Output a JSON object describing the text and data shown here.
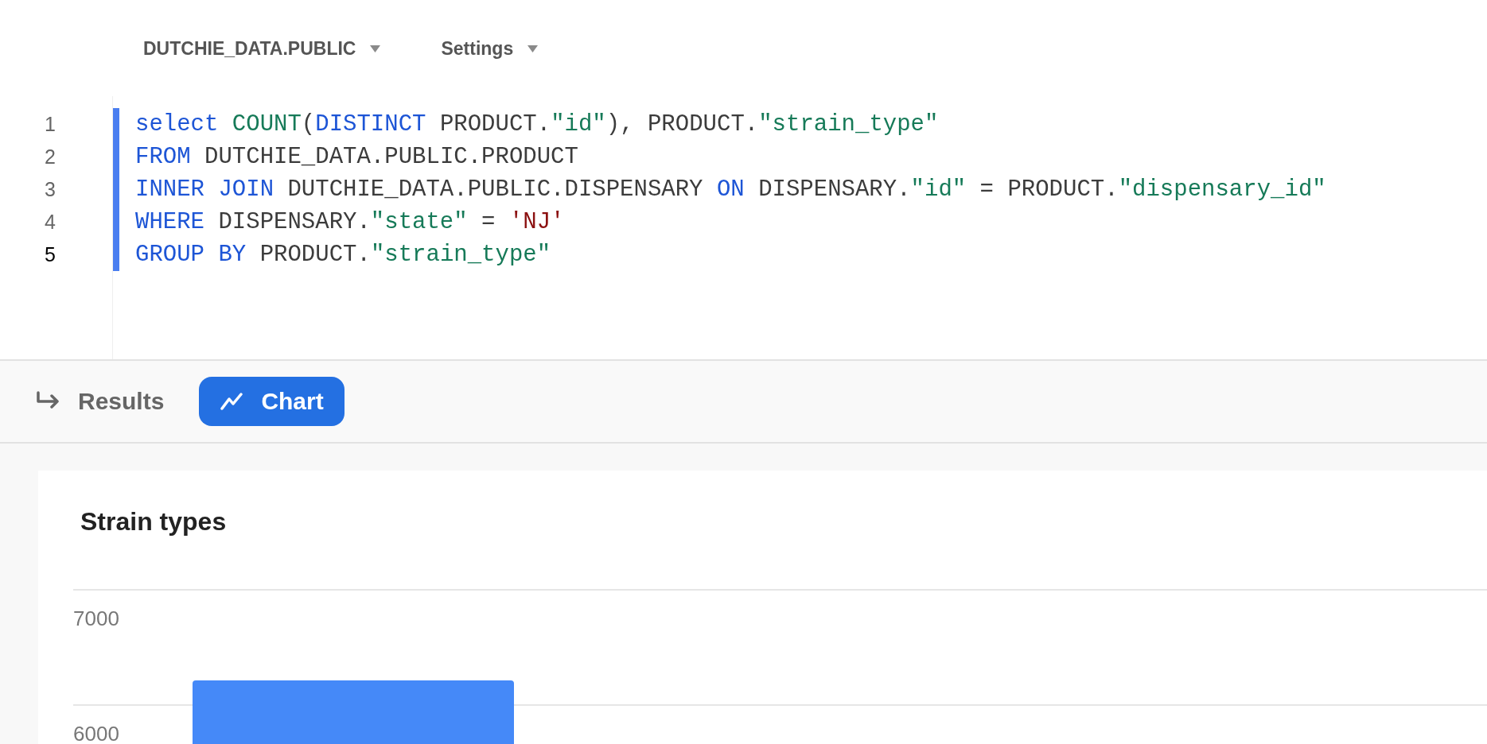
{
  "toolbar": {
    "items": [
      {
        "label": "DUTCHIE_DATA.PUBLIC"
      },
      {
        "label": "Settings"
      }
    ]
  },
  "editor": {
    "lines": [
      {
        "number": "1",
        "active": false,
        "tokens": [
          {
            "kind": "keyword",
            "text": "select "
          },
          {
            "kind": "function",
            "text": "COUNT"
          },
          {
            "kind": "plain",
            "text": "("
          },
          {
            "kind": "keyword",
            "text": "DISTINCT"
          },
          {
            "kind": "plain",
            "text": " PRODUCT."
          },
          {
            "kind": "string",
            "text": "\"id\""
          },
          {
            "kind": "plain",
            "text": "), PRODUCT."
          },
          {
            "kind": "string",
            "text": "\"strain_type\""
          }
        ]
      },
      {
        "number": "2",
        "active": false,
        "tokens": [
          {
            "kind": "keyword",
            "text": "FROM"
          },
          {
            "kind": "plain",
            "text": " DUTCHIE_DATA.PUBLIC.PRODUCT"
          }
        ]
      },
      {
        "number": "3",
        "active": false,
        "tokens": [
          {
            "kind": "keyword",
            "text": "INNER JOIN"
          },
          {
            "kind": "plain",
            "text": " DUTCHIE_DATA.PUBLIC.DISPENSARY "
          },
          {
            "kind": "keyword",
            "text": "ON"
          },
          {
            "kind": "plain",
            "text": " DISPENSARY."
          },
          {
            "kind": "string",
            "text": "\"id\""
          },
          {
            "kind": "plain",
            "text": " = PRODUCT."
          },
          {
            "kind": "string",
            "text": "\"dispensary_id\""
          }
        ]
      },
      {
        "number": "4",
        "active": false,
        "tokens": [
          {
            "kind": "keyword",
            "text": "WHERE"
          },
          {
            "kind": "plain",
            "text": " DISPENSARY."
          },
          {
            "kind": "string",
            "text": "\"state\""
          },
          {
            "kind": "plain",
            "text": " = "
          },
          {
            "kind": "literal",
            "text": "'NJ'"
          }
        ]
      },
      {
        "number": "5",
        "active": true,
        "tokens": [
          {
            "kind": "keyword",
            "text": "GROUP BY"
          },
          {
            "kind": "plain",
            "text": " PRODUCT."
          },
          {
            "kind": "string",
            "text": "\"strain_type\""
          }
        ]
      }
    ]
  },
  "result_tabs": [
    {
      "label": "Results",
      "kind": "results",
      "selected": false
    },
    {
      "label": "Chart",
      "kind": "chart",
      "selected": true
    }
  ],
  "chart_card": {
    "title": "Strain types",
    "y_axis_labels": [
      "7000",
      "6000"
    ]
  }
}
